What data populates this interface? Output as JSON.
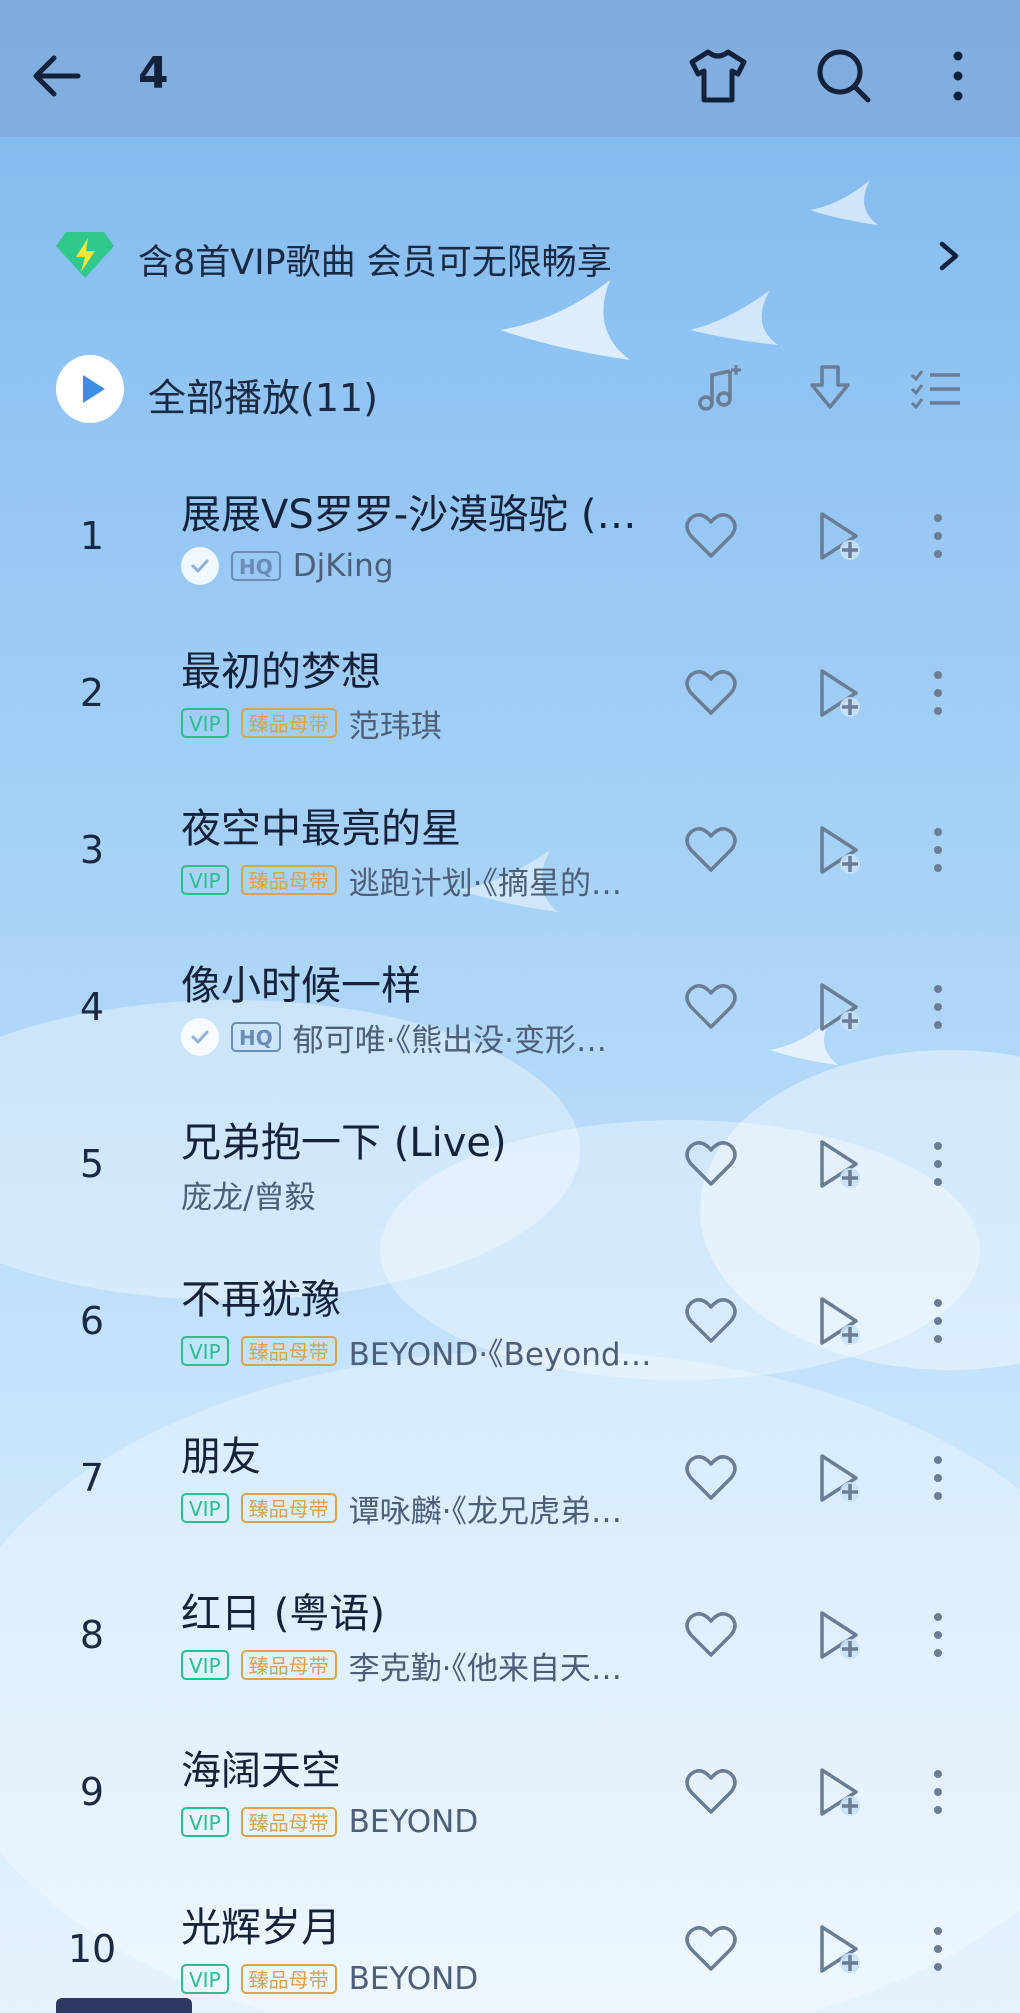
{
  "header": {
    "title": "4",
    "icons": [
      "back-arrow-icon",
      "tshirt-icon",
      "search-icon",
      "more-vertical-icon"
    ]
  },
  "vip_banner": {
    "text": "含8首VIP歌曲 会员可无限畅享",
    "icon": "vip-diamond-icon"
  },
  "play_all": {
    "label": "全部播放(11)",
    "tools": [
      "music-note-add-icon",
      "download-icon",
      "multi-select-icon"
    ]
  },
  "songs": [
    {
      "num": "1",
      "title": "展展VS罗罗-沙漠骆驼 (…",
      "tags": [
        "HQ"
      ],
      "verified": true,
      "artist": "DjKing"
    },
    {
      "num": "2",
      "title": "最初的梦想",
      "tags": [
        "VIP",
        "臻品母带"
      ],
      "verified": false,
      "artist": "范玮琪"
    },
    {
      "num": "3",
      "title": "夜空中最亮的星",
      "tags": [
        "VIP",
        "臻品母带"
      ],
      "verified": false,
      "artist": "逃跑计划·《摘星的…"
    },
    {
      "num": "4",
      "title": "像小时候一样",
      "tags": [
        "HQ"
      ],
      "verified": true,
      "artist": "郁可唯·《熊出没·变形…"
    },
    {
      "num": "5",
      "title": "兄弟抱一下 (Live)",
      "tags": [],
      "verified": false,
      "artist": "庞龙/曾毅"
    },
    {
      "num": "6",
      "title": "不再犹豫",
      "tags": [
        "VIP",
        "臻品母带"
      ],
      "verified": false,
      "artist": "BEYOND·《Beyond…"
    },
    {
      "num": "7",
      "title": "朋友",
      "tags": [
        "VIP",
        "臻品母带"
      ],
      "verified": false,
      "artist": "谭咏麟·《龙兄虎弟…"
    },
    {
      "num": "8",
      "title": "红日 (粤语)",
      "tags": [
        "VIP",
        "臻品母带"
      ],
      "verified": false,
      "artist": "李克勤·《他来自天…"
    },
    {
      "num": "9",
      "title": "海阔天空",
      "tags": [
        "VIP",
        "臻品母带"
      ],
      "verified": false,
      "artist": "BEYOND"
    },
    {
      "num": "10",
      "title": "光辉岁月",
      "tags": [
        "VIP",
        "臻品母带"
      ],
      "verified": false,
      "artist": "BEYOND"
    }
  ],
  "colors": {
    "vip_tag": "#28c08f",
    "master_tag": "#d9a34a",
    "hq_tag": "#6a8db6",
    "accent_play": "#3d8fe6"
  }
}
